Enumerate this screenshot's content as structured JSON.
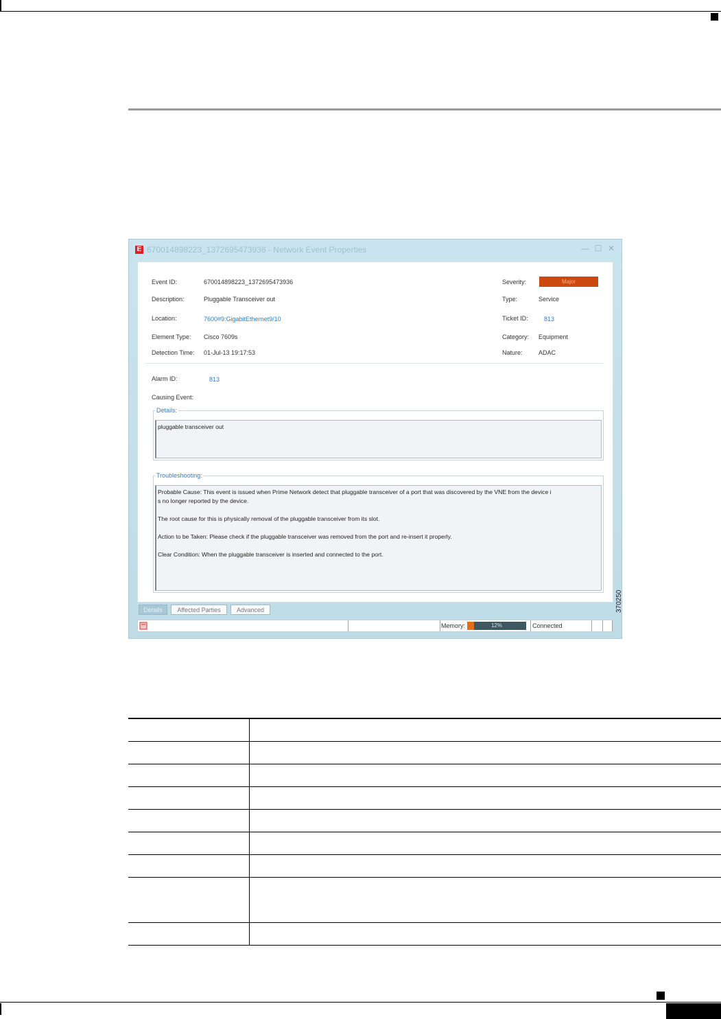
{
  "window": {
    "title": "670014898223_1372695473936 - Network Event Properties",
    "app_icon_letter": "E",
    "controls": {
      "minimize": "—",
      "maximize": "☐",
      "close": "✕"
    }
  },
  "fields": {
    "event_id_label": "Event ID:",
    "event_id_value": "670014898223_1372695473936",
    "description_label": "Description:",
    "description_value": "Pluggable Transceiver out",
    "location_label": "Location:",
    "location_value": "7600#9:GigabitEthernet9/10",
    "element_type_label": "Element Type:",
    "element_type_value": "Cisco 7609s",
    "detection_time_label": "Detection Time:",
    "detection_time_value": "01-Jul-13 19:17:53",
    "severity_label": "Severity:",
    "severity_value": "Major",
    "type_label": "Type:",
    "type_value": "Service",
    "ticket_id_label": "Ticket ID:",
    "ticket_id_value": "813",
    "category_label": "Category:",
    "category_value": "Equipment",
    "nature_label": "Nature:",
    "nature_value": "ADAC",
    "alarm_id_label": "Alarm ID:",
    "alarm_id_value": "813",
    "causing_event_label": "Causing Event:"
  },
  "details": {
    "legend": "Details:",
    "text": "pluggable transceiver out"
  },
  "troubleshooting": {
    "legend": "Troubleshooting:",
    "line1": "Probable Cause: This event is issued when Prime Network detect that pluggable transceiver of a port that was discovered by the VNE from the device i",
    "line2": "s no longer reported by the device.",
    "line3": "The root cause for this is physically removal of the pluggable transceiver from its slot.",
    "line4": "Action to be Taken: Please check if the pluggable transceiver was removed from the port and re-insert it properly.",
    "line5": "Clear Condition: When the pluggable transceiver is inserted and connected to the port."
  },
  "tabs": [
    "Details",
    "Affected Parties",
    "Advanced"
  ],
  "status_bar": {
    "memory_label": "Memory:",
    "memory_percent": 12,
    "memory_text": "12%",
    "connection": "Connected"
  },
  "figure_id": "370250"
}
